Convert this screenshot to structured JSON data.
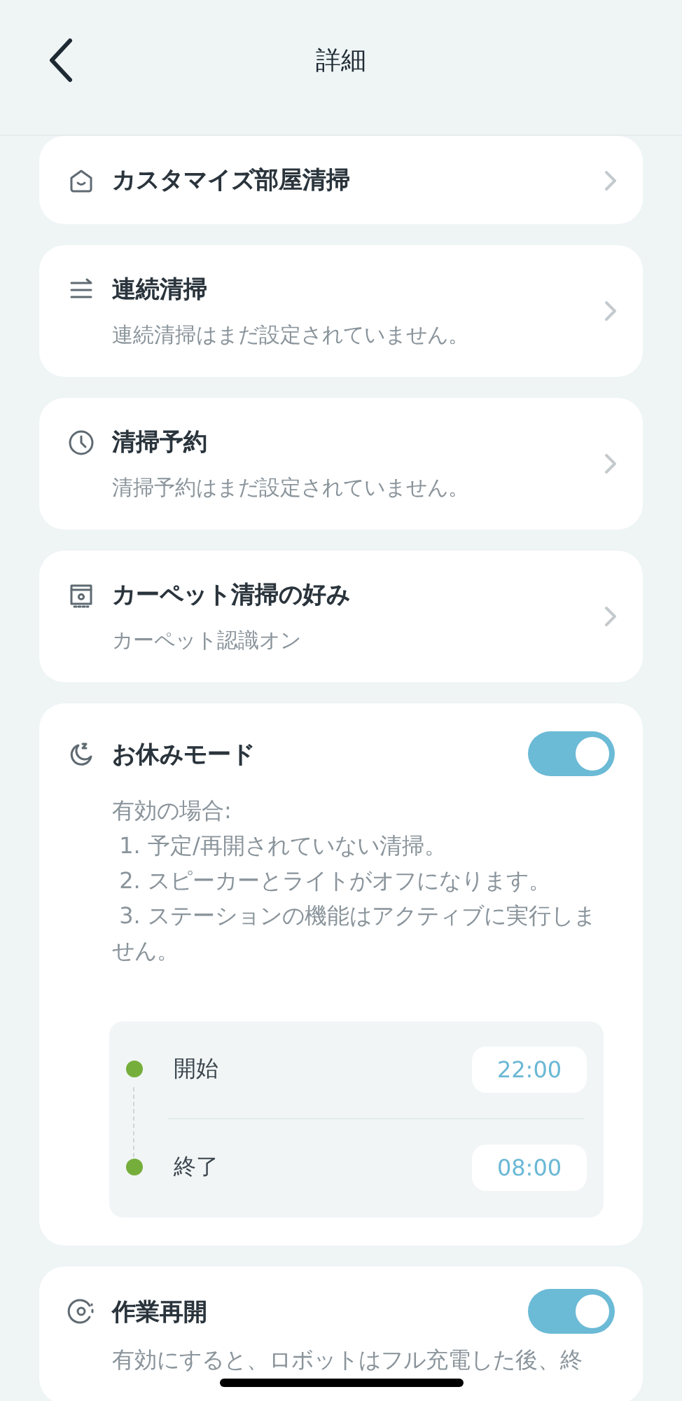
{
  "header": {
    "title": "詳細"
  },
  "cards": [
    {
      "kind": "link",
      "title": "カスタマイズ部屋清掃"
    },
    {
      "kind": "link",
      "title": "連続清掃",
      "subtitle": "連続清掃はまだ設定されていません。"
    },
    {
      "kind": "link",
      "title": "清掃予約",
      "subtitle": "清掃予約はまだ設定されていません。"
    },
    {
      "kind": "link",
      "title": "カーペット清掃の好み",
      "subtitle": "カーペット認識オン"
    },
    {
      "kind": "toggle",
      "title": "お休みモード",
      "on": true,
      "description": [
        "有効の場合:",
        " 1. 予定/再開されていない清掃。",
        " 2. スピーカーとライトがオフになります。",
        " 3. ステーションの機能はアクティブに実行しません。"
      ],
      "schedule": [
        {
          "label": "開始",
          "time": "22:00"
        },
        {
          "label": "終了",
          "time": "08:00"
        }
      ]
    },
    {
      "kind": "toggle",
      "title": "作業再開",
      "on": true,
      "description": [
        "有効にすると、ロボットはフル充電した後、終"
      ]
    }
  ]
}
